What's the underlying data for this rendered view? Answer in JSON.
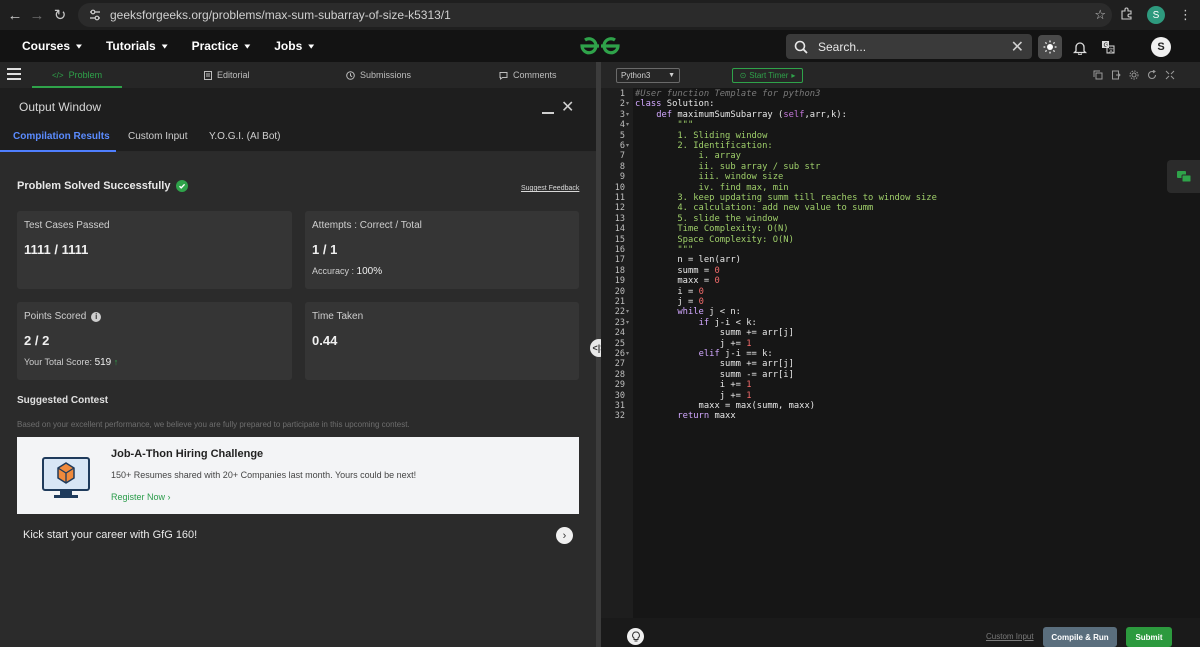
{
  "browser": {
    "url": "geeksforgeeks.org/problems/max-sum-subarray-of-size-k5313/1",
    "profile_letter": "S"
  },
  "header": {
    "menu": [
      "Courses",
      "Tutorials",
      "Practice",
      "Jobs"
    ],
    "search_placeholder": "Search...",
    "profile_letter": "S"
  },
  "problem_tabs": [
    "Problem",
    "Editorial",
    "Submissions",
    "Comments"
  ],
  "output": {
    "title": "Output Window",
    "tabs": [
      "Compilation Results",
      "Custom Input",
      "Y.O.G.I. (AI Bot)"
    ],
    "status": "Problem Solved Successfully",
    "feedback_link": "Suggest Feedback",
    "cards": {
      "tests_label": "Test Cases Passed",
      "tests_value": "1111 / 1111",
      "attempts_label": "Attempts : Correct / Total",
      "attempts_value": "1 / 1",
      "accuracy_label": "Accuracy :",
      "accuracy_value": "100%",
      "points_label": "Points Scored",
      "points_value": "2 / 2",
      "total_label": "Your Total Score:",
      "total_value": "519",
      "time_label": "Time Taken",
      "time_value": "0.44"
    },
    "suggested": {
      "heading": "Suggested Contest",
      "text": "Based on your excellent performance, we believe you are fully prepared to participate in this upcoming contest.",
      "contest_title": "Job-A-Thon Hiring Challenge",
      "contest_desc": "150+ Resumes shared with 20+ Companies last month. Yours could be next!",
      "register": "Register Now ›",
      "kick": "Kick start your career with GfG 160!"
    }
  },
  "editor": {
    "language": "Python3",
    "timer": "Start Timer",
    "custom_input": "Custom Input",
    "compile": "Compile & Run",
    "submit": "Submit",
    "lines": [
      "#User function Template for python3",
      "class Solution:",
      "    def maximumSumSubarray (self,arr,k):",
      "        \"\"\"",
      "        1. Sliding window",
      "        2. Identification:",
      "            i. array",
      "            ii. sub array / sub str",
      "            iii. window size",
      "            iv. find max, min",
      "        3. keep updating summ till reaches to window size",
      "        4. calculation: add new value to summ",
      "        5. slide the window",
      "        Time Complexity: O(N)",
      "        Space Complexity: O(N)",
      "        \"\"\"",
      "        n = len(arr)",
      "        summ = 0",
      "        maxx = 0",
      "        i = 0",
      "        j = 0",
      "        while j < n:",
      "            if j-i < k:",
      "                summ += arr[j]",
      "                j += 1",
      "            elif j-i == k:",
      "                summ += arr[j]",
      "                summ -= arr[i]",
      "                i += 1",
      "                j += 1",
      "            maxx = max(summ, maxx)",
      "        return maxx"
    ]
  }
}
